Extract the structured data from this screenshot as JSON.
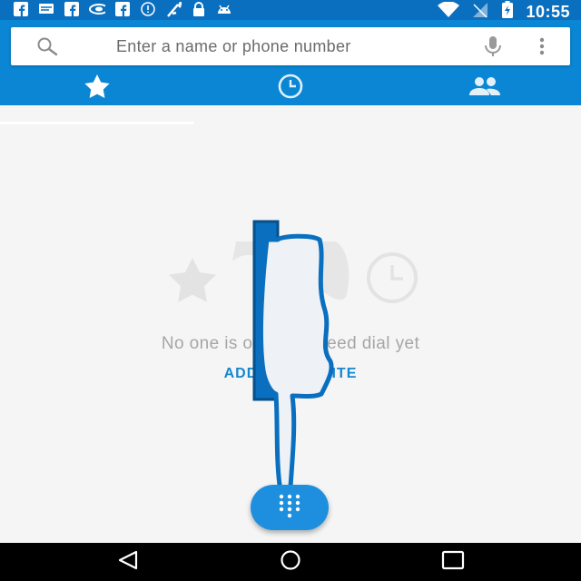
{
  "status_bar": {
    "time": "10:55",
    "left_icons": [
      "facebook-icon",
      "message-icon",
      "facebook-icon",
      "vpn-icon",
      "facebook-icon",
      "alert-icon",
      "signal-boost-icon",
      "lock-icon",
      "android-icon"
    ],
    "right_icons": [
      "wifi-icon",
      "no-signal-icon",
      "battery-charging-icon"
    ]
  },
  "search": {
    "placeholder": "Enter a name or phone number"
  },
  "tabs": [
    {
      "icon": "star-icon",
      "selected": true
    },
    {
      "icon": "clock-icon",
      "selected": false
    },
    {
      "icon": "people-icon",
      "selected": false
    }
  ],
  "empty_state": {
    "message": "No one is on your speed dial yet",
    "action_label": "ADD A FAVORITE"
  },
  "fab": {
    "icon": "dialpad-icon"
  },
  "navigation": {
    "buttons": [
      "back-icon",
      "home-icon",
      "recents-icon"
    ]
  },
  "colors": {
    "status_bar": "#0a6fbf",
    "app_bar": "#0a86d4",
    "accent": "#1787cf",
    "fab": "#1e8fde",
    "background": "#f5f5f5"
  }
}
